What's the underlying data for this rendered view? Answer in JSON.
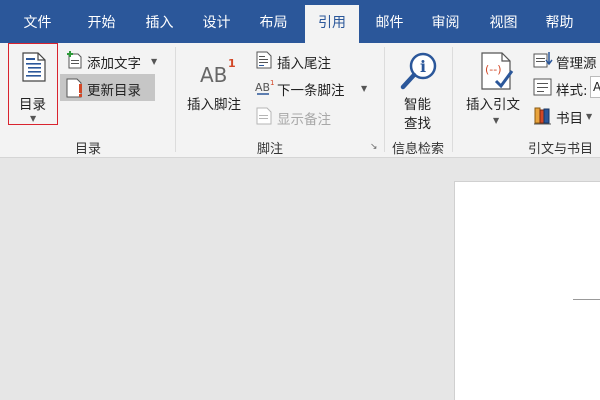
{
  "tabs": [
    {
      "label": "文件",
      "active": false
    },
    {
      "label": "开始",
      "active": false
    },
    {
      "label": "插入",
      "active": false
    },
    {
      "label": "设计",
      "active": false
    },
    {
      "label": "布局",
      "active": false
    },
    {
      "label": "引用",
      "active": true
    },
    {
      "label": "邮件",
      "active": false
    },
    {
      "label": "审阅",
      "active": false
    },
    {
      "label": "视图",
      "active": false
    },
    {
      "label": "帮助",
      "active": false
    }
  ],
  "groups": {
    "toc": {
      "label": "目录",
      "toc_button": "目录",
      "add_text": "添加文字",
      "update_toc": "更新目录"
    },
    "footnotes": {
      "label": "脚注",
      "insert_footnote": "插入脚注",
      "insert_endnote": "插入尾注",
      "next_footnote": "下一条脚注",
      "show_notes": "显示备注",
      "ab_text": "AB",
      "sup_text": "1"
    },
    "research": {
      "label": "信息检索",
      "smart_lookup_1": "智能",
      "smart_lookup_2": "查找"
    },
    "citations": {
      "label": "引文与书目",
      "insert_citation": "插入引文",
      "manage_sources": "管理源",
      "style_label": "样式:",
      "style_value": "A",
      "bibliography": "书目"
    }
  },
  "colors": {
    "tabbar": "#2b579a",
    "ribbon": "#f3f3f3",
    "highlight_border": "#d9232e",
    "accent_red": "#d24726"
  }
}
